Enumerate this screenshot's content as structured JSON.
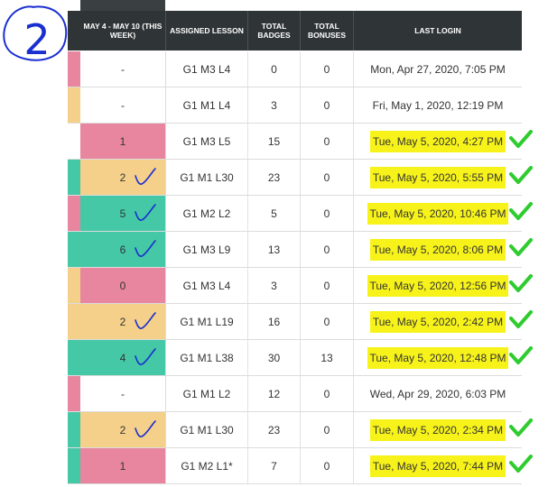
{
  "circled_number": "2",
  "headers": {
    "week": "MAY 4 - MAY 10 (THIS WEEK)",
    "lesson": "ASSIGNED LESSON",
    "badges": "TOTAL BADGES",
    "bonuses": "TOTAL BONUSES",
    "login": "LAST LOGIN"
  },
  "colors": {
    "pink": "#e8869f",
    "orange": "#f4d08a",
    "teal": "#45c8a6",
    "highlight": "#f7f31a",
    "check_green": "#2ecc2e",
    "ink_blue": "#1a2fd0"
  },
  "rows": [
    {
      "strip": "pink",
      "week": "-",
      "week_color": "none",
      "lesson": "G1 M3 L4",
      "badges": "0",
      "bonuses": "0",
      "login": "Mon, Apr 27, 2020, 7:05 PM",
      "highlighted": false,
      "green_check": false,
      "blue_check": false
    },
    {
      "strip": "orange",
      "week": "-",
      "week_color": "none",
      "lesson": "G1 M1 L4",
      "badges": "3",
      "bonuses": "0",
      "login": "Fri, May 1, 2020, 12:19 PM",
      "highlighted": false,
      "green_check": false,
      "blue_check": false
    },
    {
      "strip": "none",
      "week": "1",
      "week_color": "pink",
      "lesson": "G1 M3 L5",
      "badges": "15",
      "bonuses": "0",
      "login": "Tue, May 5, 2020, 4:27 PM",
      "highlighted": true,
      "green_check": true,
      "blue_check": false
    },
    {
      "strip": "teal",
      "week": "2",
      "week_color": "orange",
      "lesson": "G1 M1 L30",
      "badges": "23",
      "bonuses": "0",
      "login": "Tue, May 5, 2020, 5:55 PM",
      "highlighted": true,
      "green_check": true,
      "blue_check": true
    },
    {
      "strip": "pink",
      "week": "5",
      "week_color": "teal",
      "lesson": "G1 M2 L2",
      "badges": "5",
      "bonuses": "0",
      "login": "Tue, May 5, 2020, 10:46 PM",
      "highlighted": true,
      "green_check": true,
      "blue_check": true
    },
    {
      "strip": "teal",
      "week": "6",
      "week_color": "teal",
      "lesson": "G1 M3 L9",
      "badges": "13",
      "bonuses": "0",
      "login": "Tue, May 5, 2020, 8:06 PM",
      "highlighted": true,
      "green_check": true,
      "blue_check": true
    },
    {
      "strip": "orange",
      "week": "0",
      "week_color": "pink",
      "lesson": "G1 M3 L4",
      "badges": "3",
      "bonuses": "0",
      "login": "Tue, May 5, 2020, 12:56 PM",
      "highlighted": true,
      "green_check": true,
      "blue_check": false
    },
    {
      "strip": "orange",
      "week": "2",
      "week_color": "orange",
      "lesson": "G1 M1 L19",
      "badges": "16",
      "bonuses": "0",
      "login": "Tue, May 5, 2020, 2:42 PM",
      "highlighted": true,
      "green_check": true,
      "blue_check": true
    },
    {
      "strip": "teal",
      "week": "4",
      "week_color": "teal",
      "lesson": "G1 M1 L38",
      "badges": "30",
      "bonuses": "13",
      "login": "Tue, May 5, 2020, 12:48 PM",
      "highlighted": true,
      "green_check": true,
      "blue_check": true
    },
    {
      "strip": "pink",
      "week": "-",
      "week_color": "none",
      "lesson": "G1 M1 L2",
      "badges": "12",
      "bonuses": "0",
      "login": "Wed, Apr 29, 2020, 6:03 PM",
      "highlighted": false,
      "green_check": false,
      "blue_check": false
    },
    {
      "strip": "teal",
      "week": "2",
      "week_color": "orange",
      "lesson": "G1 M1 L30",
      "badges": "23",
      "bonuses": "0",
      "login": "Tue, May 5, 2020, 2:34 PM",
      "highlighted": true,
      "green_check": true,
      "blue_check": true
    },
    {
      "strip": "teal",
      "week": "1",
      "week_color": "pink",
      "lesson": "G1 M2 L1*",
      "badges": "7",
      "bonuses": "0",
      "login": "Tue, May 5, 2020, 7:44 PM",
      "highlighted": true,
      "green_check": true,
      "blue_check": false
    }
  ]
}
